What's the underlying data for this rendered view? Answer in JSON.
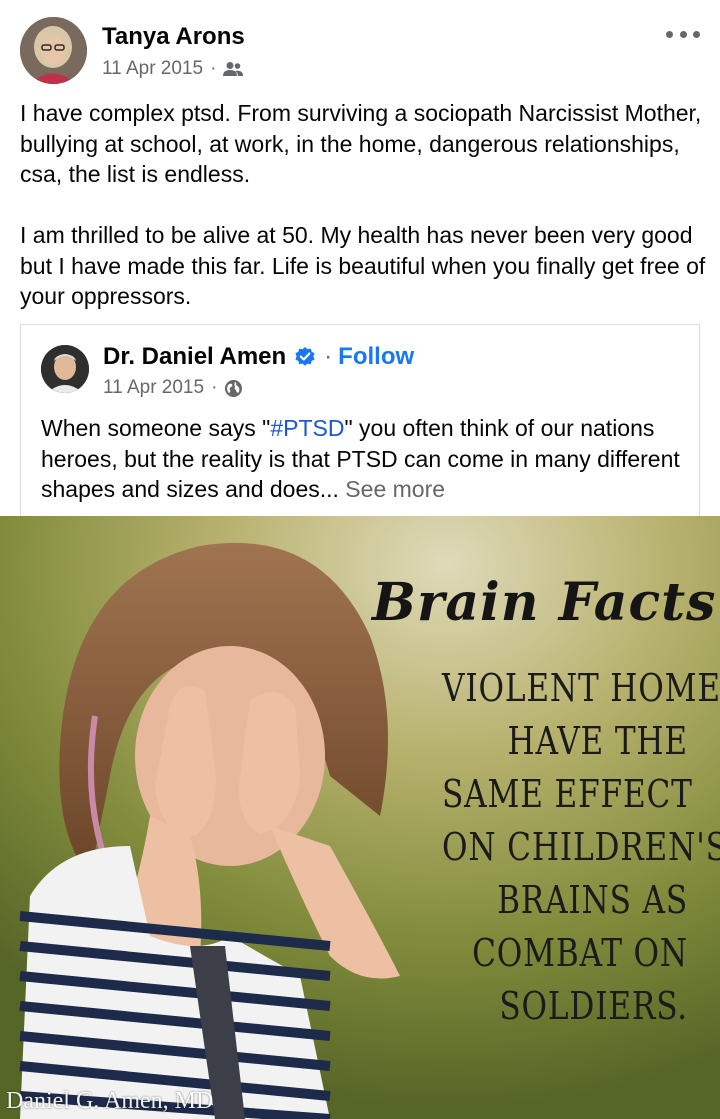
{
  "post": {
    "author_name": "Tanya Arons",
    "date": "11 Apr 2015",
    "separator": "·",
    "audience_icon": "friends-icon",
    "text_paragraphs": [
      "I have complex ptsd.  From surviving a sociopath Narcissist Mother, bullying at school, at work, in the home, dangerous relationships, csa, the list is endless.",
      "I am thrilled to be alive at 50.  My health has never been very good but I have made this far. Life is beautiful when you finally get free of your oppressors."
    ]
  },
  "shared": {
    "author_name": "Dr. Daniel Amen",
    "verified_icon": "verified-badge-icon",
    "separator": "·",
    "follow_label": "Follow",
    "date": "11 Apr 2015",
    "audience_icon": "globe-icon",
    "text_before_hashtag": "When someone says \"",
    "hashtag": "#PTSD",
    "text_after_hashtag": "\" you often think of our nations heroes, but the reality is that PTSD can come in many different shapes and sizes and does...",
    "see_more_label": " See more"
  },
  "image": {
    "title": "Brain Facts",
    "lines": [
      "VIOLENT HOMES",
      "HAVE THE",
      "SAME EFFECT",
      "ON CHILDREN'S",
      "BRAINS AS",
      "COMBAT ON",
      "SOLDIERS."
    ],
    "watermark": "Daniel G. Amen, MD"
  },
  "colors": {
    "link_blue": "#1877f2",
    "meta_gray": "#65676b",
    "text": "#050505"
  }
}
